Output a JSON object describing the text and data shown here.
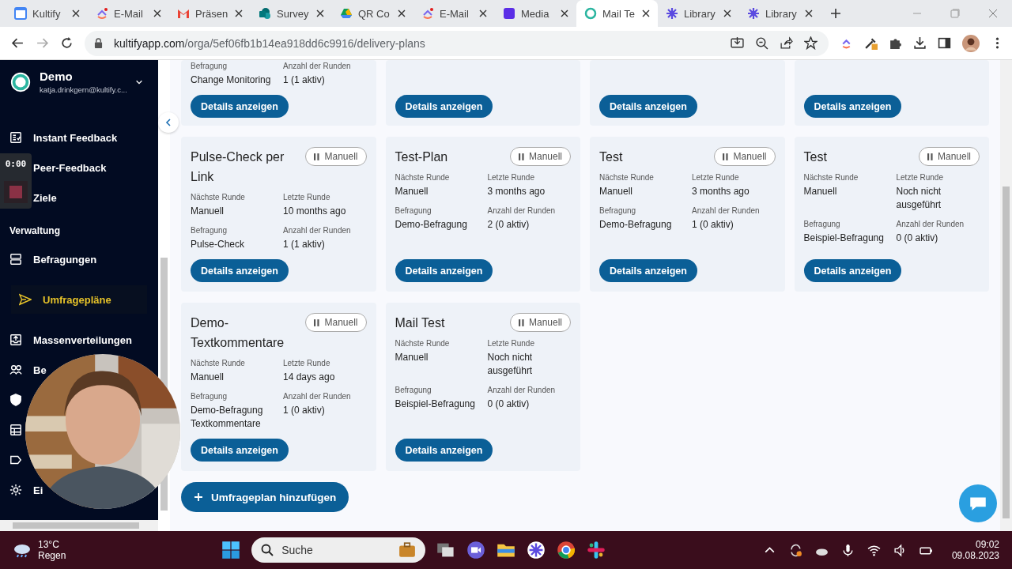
{
  "browser": {
    "tabs": [
      {
        "label": "Kultify",
        "selected": false
      },
      {
        "label": "E-Mail",
        "selected": false
      },
      {
        "label": "Präsen",
        "selected": false
      },
      {
        "label": "Survey",
        "selected": false
      },
      {
        "label": "QR Co",
        "selected": false
      },
      {
        "label": "E-Mail",
        "selected": false
      },
      {
        "label": "Media",
        "selected": false
      },
      {
        "label": "Mail Te",
        "selected": true
      },
      {
        "label": "Library",
        "selected": false
      },
      {
        "label": "Library",
        "selected": false
      }
    ],
    "url": {
      "host": "kultifyapp.com",
      "path": "/orga/5ef06fb1b14ea918dd6c9916/delivery-plans"
    }
  },
  "sidebar": {
    "org": "Demo",
    "email": "katja.drinkgern@kultify.c...",
    "items": [
      {
        "kind": "item",
        "label": "Instant Feedback",
        "selected": false
      },
      {
        "kind": "item",
        "label": "Peer-Feedback",
        "selected": false
      },
      {
        "kind": "item",
        "label": "Ziele",
        "selected": false
      },
      {
        "kind": "section",
        "label": "Verwaltung"
      },
      {
        "kind": "item",
        "label": "Befragungen",
        "selected": false
      },
      {
        "kind": "item",
        "label": "Umfragepläne",
        "selected": true
      },
      {
        "kind": "item",
        "label": "Massenverteilungen",
        "selected": false
      },
      {
        "kind": "item",
        "label": "Be",
        "selected": false
      },
      {
        "kind": "item",
        "selected": false
      },
      {
        "kind": "item",
        "selected": false
      },
      {
        "kind": "item",
        "selected": false
      },
      {
        "kind": "item",
        "label": "Ei",
        "selected": false
      }
    ]
  },
  "recorder": {
    "time": "0:00"
  },
  "plans": [
    {
      "fields": [
        {
          "label": "Befragung",
          "value": "Change Monitoring"
        },
        {
          "label": "Anzahl der Runden",
          "value": "1 (1 aktiv)"
        }
      ],
      "button": "Details anzeigen"
    },
    {
      "button": "Details anzeigen"
    },
    {
      "button": "Details anzeigen"
    },
    {
      "button": "Details anzeigen"
    },
    {
      "title": "Pulse-Check per Link",
      "mode": "Manuell",
      "fields": [
        {
          "label": "Nächste Runde",
          "value": "Manuell"
        },
        {
          "label": "Letzte Runde",
          "value": "10 months ago"
        },
        {
          "label": "Befragung",
          "value": "Pulse-Check"
        },
        {
          "label": "Anzahl der Runden",
          "value": "1 (1 aktiv)"
        }
      ],
      "button": "Details anzeigen"
    },
    {
      "title": "Test-Plan",
      "mode": "Manuell",
      "fields": [
        {
          "label": "Nächste Runde",
          "value": "Manuell"
        },
        {
          "label": "Letzte Runde",
          "value": "3 months ago"
        },
        {
          "label": "Befragung",
          "value": "Demo-Befragung"
        },
        {
          "label": "Anzahl der Runden",
          "value": "2 (0 aktiv)"
        }
      ],
      "button": "Details anzeigen"
    },
    {
      "title": "Test",
      "mode": "Manuell",
      "fields": [
        {
          "label": "Nächste Runde",
          "value": "Manuell"
        },
        {
          "label": "Letzte Runde",
          "value": "3 months ago"
        },
        {
          "label": "Befragung",
          "value": "Demo-Befragung"
        },
        {
          "label": "Anzahl der Runden",
          "value": "1 (0 aktiv)"
        }
      ],
      "button": "Details anzeigen"
    },
    {
      "title": "Test",
      "mode": "Manuell",
      "fields": [
        {
          "label": "Nächste Runde",
          "value": "Manuell"
        },
        {
          "label": "Letzte Runde",
          "value": "Noch nicht ausgeführt"
        },
        {
          "label": "Befragung",
          "value": "Beispiel-Befragung"
        },
        {
          "label": "Anzahl der Runden",
          "value": "0 (0 aktiv)"
        }
      ],
      "button": "Details anzeigen"
    },
    {
      "title": "Demo-Textkommentare",
      "mode": "Manuell",
      "fields": [
        {
          "label": "Nächste Runde",
          "value": "Manuell"
        },
        {
          "label": "Letzte Runde",
          "value": "14 days ago"
        },
        {
          "label": "Befragung",
          "value": "Demo-Befragung Textkommentare"
        },
        {
          "label": "Anzahl der Runden",
          "value": "1 (0 aktiv)"
        }
      ],
      "button": "Details anzeigen"
    },
    {
      "title": "Mail Test",
      "mode": "Manuell",
      "fields": [
        {
          "label": "Nächste Runde",
          "value": "Manuell"
        },
        {
          "label": "Letzte Runde",
          "value": "Noch nicht ausgeführt"
        },
        {
          "label": "Befragung",
          "value": "Beispiel-Befragung"
        },
        {
          "label": "Anzahl der Runden",
          "value": "0 (0 aktiv)"
        }
      ],
      "button": "Details anzeigen"
    }
  ],
  "add_button": "Umfrageplan hinzufügen",
  "taskbar": {
    "temperature": "13°C",
    "weather": "Regen",
    "search": "Suche",
    "time": "09:02",
    "date": "09.08.2023"
  }
}
